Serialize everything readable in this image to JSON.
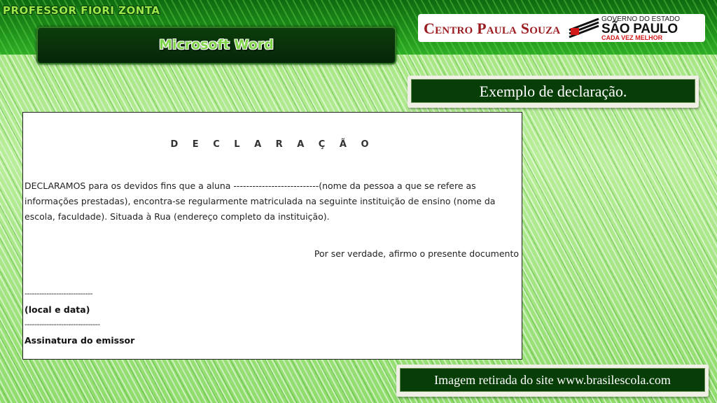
{
  "header": {
    "professor_banner": "PROFESSOR FIORI ZONTA",
    "topic_title": "Microsoft Word"
  },
  "logos": {
    "centro": "Centro Paula Souza",
    "governo": "GOVERNO DO ESTADO",
    "estado": "SÃO PAULO",
    "slogan": "CADA VEZ MELHOR"
  },
  "caption": "Exemplo de declaração.",
  "document": {
    "heading": "D E C L A R A Ç Ã O",
    "paragraph": "DECLARAMOS para os devidos fins que a aluna ---------------------------(nome da pessoa a que se refere as informações prestadas), encontra-se regularmente matriculada na seguinte instituição de ensino (nome da escola, faculdade). Situada à Rua (endereço completo da instituição).",
    "closing": "Por ser verdade, afirmo o presente documento",
    "sig_line_1": "----------------------------",
    "place_date": "(local e data)",
    "sig_line_2": "-------------------------------",
    "signer": "Assinatura do emissor"
  },
  "source": "Imagem retirada do site www.brasilescola.com",
  "colors": {
    "dark_green": "#073d07",
    "light_green": "#9ee27a",
    "cps_red": "#9b1c20",
    "sp_red": "#d21a1a"
  }
}
